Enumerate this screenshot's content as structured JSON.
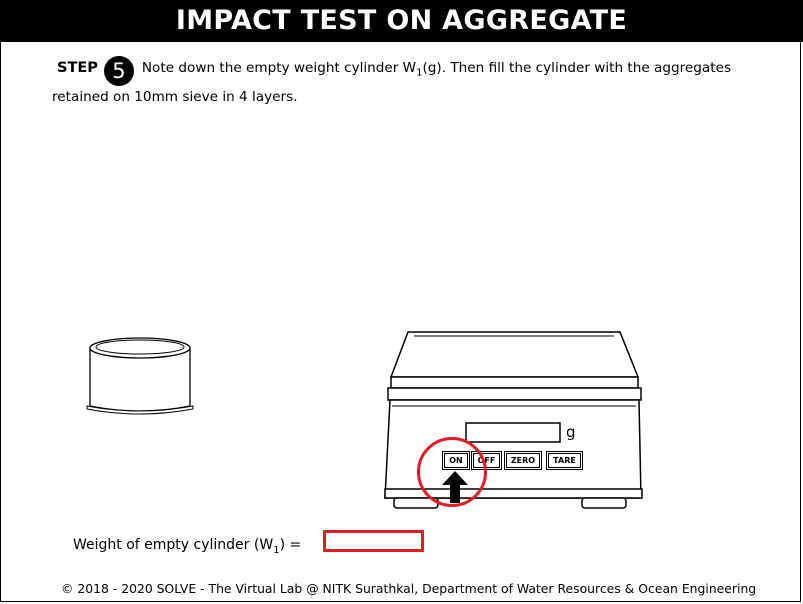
{
  "title": "IMPACT TEST ON AGGREGATE",
  "step": {
    "label": "STEP",
    "number": "5",
    "text_before_sub": "Note down the empty weight cylinder W",
    "sub": "1",
    "text_after_sub": "(g). Then fill the cylinder with the aggregates retained on 10mm sieve in 4 layers."
  },
  "scale": {
    "unit": "g",
    "buttons": {
      "on": "ON",
      "off": "OFF",
      "zero": "ZERO",
      "tare": "TARE"
    }
  },
  "weight_field": {
    "label_before": "Weight of empty cylinder (W",
    "sub": "1",
    "label_after": ") =",
    "value": ""
  },
  "footer": "© 2018 - 2020 SOLVE - The Virtual Lab @ NITK Surathkal, Department of Water Resources & Ocean Engineering",
  "colors": {
    "title_bg": "#000000",
    "highlight": "#e41b23"
  },
  "icons": [
    "step-number-badge",
    "cylinder-illustration",
    "weighing-scale-illustration",
    "arrow-up-icon"
  ]
}
